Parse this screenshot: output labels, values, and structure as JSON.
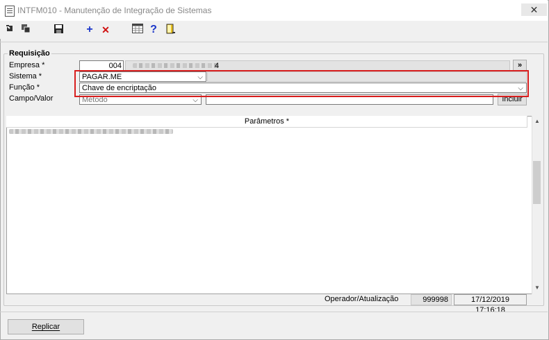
{
  "window": {
    "title": "INTFM010 - Manutenção de Integração de Sistemas",
    "close_glyph": "✕"
  },
  "toolbar": {
    "icons": [
      "first-record-icon",
      "copy-icon",
      "save-icon",
      "add-icon",
      "delete-icon",
      "calendar-grid-icon",
      "help-icon",
      "exit-door-icon"
    ],
    "add_glyph": "+",
    "delete_glyph": "✕",
    "help_glyph": "?"
  },
  "form": {
    "group_title": "Requisição",
    "empresa": {
      "label": "Empresa *",
      "code": "004",
      "name_obscured": "4",
      "nav_button": "»"
    },
    "sistema": {
      "label": "Sistema *",
      "value": "PAGAR.ME"
    },
    "funcao": {
      "label": "Função *",
      "value": "Chave de encriptação"
    },
    "campo_valor": {
      "label": "Campo/Valor",
      "select_value": "Método",
      "text_value": "",
      "include_button": "Incluir"
    }
  },
  "parameters": {
    "header": "Parâmetros *",
    "rows_obscured": 1
  },
  "footer": {
    "operator_label": "Operador/Atualização",
    "operator_code": "999998",
    "timestamp": "17/12/2019 17:16:18",
    "replicate_button": "Replicar"
  },
  "colors": {
    "highlight": "#d81e1e",
    "accent_blue": "#1a35c9",
    "delete_red": "#d01010"
  }
}
